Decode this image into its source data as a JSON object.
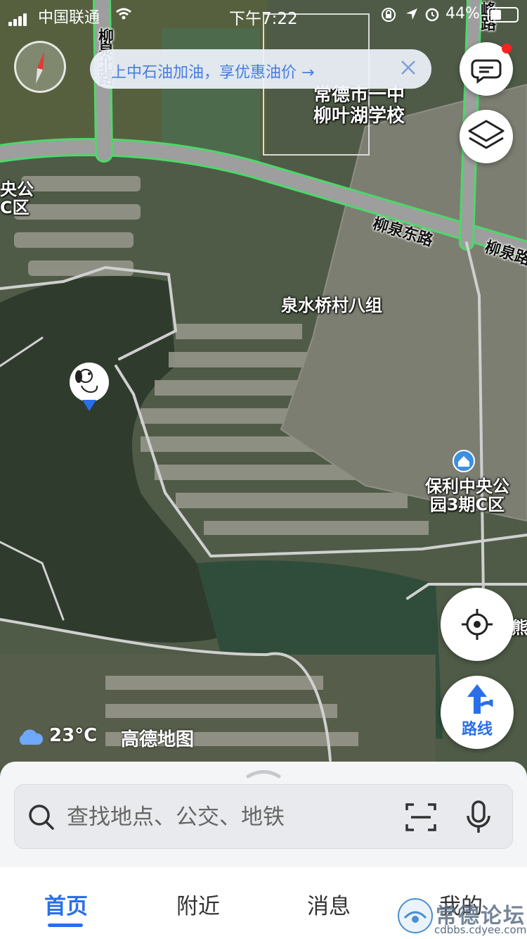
{
  "status_bar": {
    "carrier": "中国联通",
    "time": "下午7:22",
    "battery_percent": "44%"
  },
  "promo": {
    "text": "上中石油加油，享优惠油价 →"
  },
  "map_labels": {
    "school_line1": "常德市一中",
    "school_line2": "柳叶湖学校",
    "village": "泉水桥村八组",
    "poi_line1": "保利中央公",
    "poi_line2": "园3期C区",
    "left_edge_line1": "央公",
    "left_edge_line2": "C区",
    "right_edge": "熊"
  },
  "road_labels": {
    "liuquan_east": "柳泉东路",
    "liuquan_right": "柳泉路",
    "vertical_left": "柳泉北路",
    "vertical_right_top": "峰路"
  },
  "weather": {
    "temperature": "23°C",
    "brand": "高德地图"
  },
  "route_button": {
    "label": "路线"
  },
  "search": {
    "placeholder": "查找地点、公交、地铁"
  },
  "tabs": [
    {
      "label": "首页",
      "active": true
    },
    {
      "label": "附近",
      "active": false
    },
    {
      "label": "消息",
      "active": false
    },
    {
      "label": "我的",
      "active": false
    }
  ],
  "watermark": {
    "text": "常德论坛",
    "url": "cdbbs.cdyee.com"
  },
  "colors": {
    "accent": "#2a6fe8",
    "road_outline": "#4dd86a",
    "notification": "#ff2222"
  }
}
